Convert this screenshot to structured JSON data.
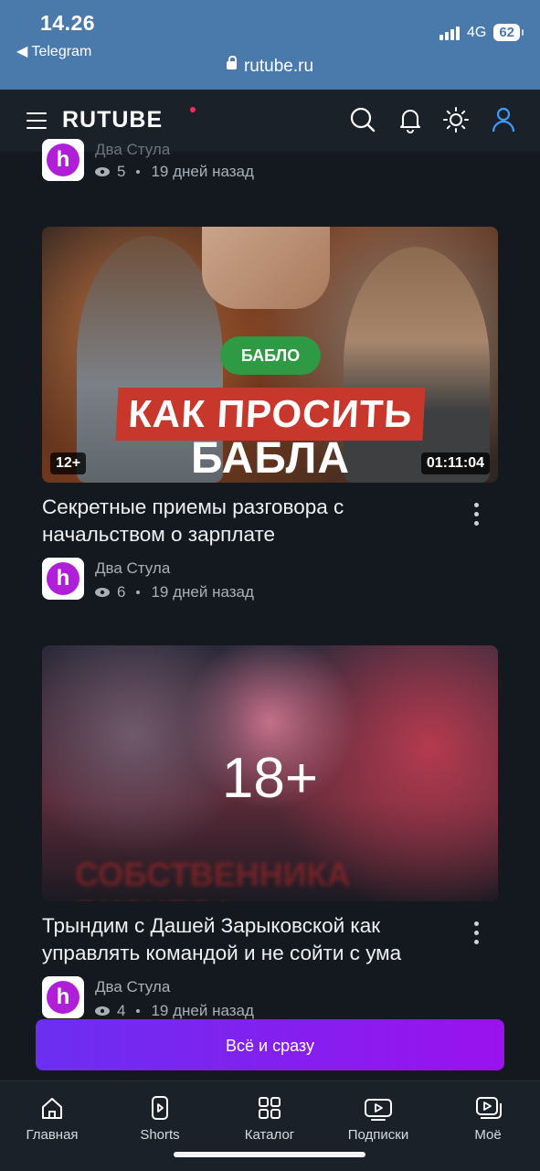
{
  "status_bar": {
    "time": "14.26",
    "back_app": "◀ Telegram",
    "network": "4G",
    "battery": "62",
    "url": "rutube.ru"
  },
  "header": {
    "logo": "RUTUBE"
  },
  "top_partial": {
    "channel": "Два Стула",
    "views": "5",
    "age": "19 дней назад"
  },
  "videos": [
    {
      "thumb_pill": "БАБЛО",
      "thumb_line1": "КАК ПРОСИТЬ",
      "thumb_line2": "БАБЛА",
      "age_badge": "12+",
      "duration": "01:11:04",
      "title": "Секретные приемы разговора с начальством о зарплате",
      "channel": "Два Стула",
      "views": "6",
      "age": "19 дней назад"
    },
    {
      "age_overlay": "18+",
      "thumb_text": "СОБСТВЕННИКА БИЗНЕСА",
      "title": "Трындим с Дашей Зарыковской как управлять командой и не сойти с ума",
      "channel": "Два Стула",
      "views": "4",
      "age": "19 дней назад"
    }
  ],
  "cta": {
    "label": "Всё и сразу"
  },
  "tabs": [
    {
      "label": "Главная",
      "icon": "home-icon"
    },
    {
      "label": "Shorts",
      "icon": "shorts-icon"
    },
    {
      "label": "Каталог",
      "icon": "catalog-icon"
    },
    {
      "label": "Подписки",
      "icon": "subscriptions-icon"
    },
    {
      "label": "Моё",
      "icon": "my-icon"
    }
  ],
  "avatar_letter": "h"
}
